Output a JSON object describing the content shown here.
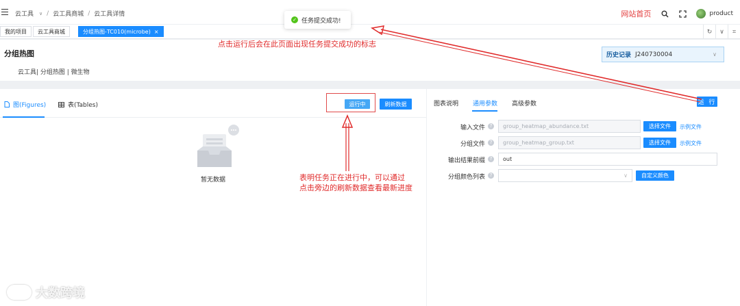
{
  "topbar": {
    "breadcrumb": [
      "云工具",
      "云工具商城",
      "云工具详情"
    ],
    "toast": "任务提交成功!",
    "homepage": "网站首页",
    "username": "product"
  },
  "tabs": [
    {
      "label": "我的项目"
    },
    {
      "label": "云工具商城"
    },
    {
      "label": "分组热图-TC010(microbe)",
      "active": true
    }
  ],
  "header": {
    "title": "分组热图",
    "tags": "云工具| 分组热图 | 微生物",
    "history_label": "历史记录",
    "history_value": "J240730004"
  },
  "left": {
    "tab_figures": "图(Figures)",
    "tab_tables": "表(Tables)",
    "running_label": "运行中",
    "refresh_label": "刷新数据",
    "empty_text": "暂无数据"
  },
  "right": {
    "tabs": [
      "图表说明",
      "通用参数",
      "高级参数"
    ],
    "run_label": "运 行",
    "fields": {
      "input_file": {
        "label": "输入文件",
        "value": "group_heatmap_abundance.txt"
      },
      "group_file": {
        "label": "分组文件",
        "value": "group_heatmap_group.txt"
      },
      "output_prefix": {
        "label": "输出结果前缀",
        "value": "out"
      },
      "group_colors": {
        "label": "分组颜色列表",
        "value": ""
      }
    },
    "choose_file": "选择文件",
    "sample_file": "示例文件",
    "custom_color": "自定义颜色"
  },
  "annotations": {
    "top": "点击运行后会在此页面出现任务提交成功的标志",
    "middle_line1": "表明任务正在进行中，可以通过",
    "middle_line2": "点击旁边的刷新数据查看最新进度"
  },
  "watermark": "大数跨境",
  "colors": {
    "primary": "#1a8cff",
    "annotation": "#e02b2b",
    "success": "#52c41a"
  }
}
